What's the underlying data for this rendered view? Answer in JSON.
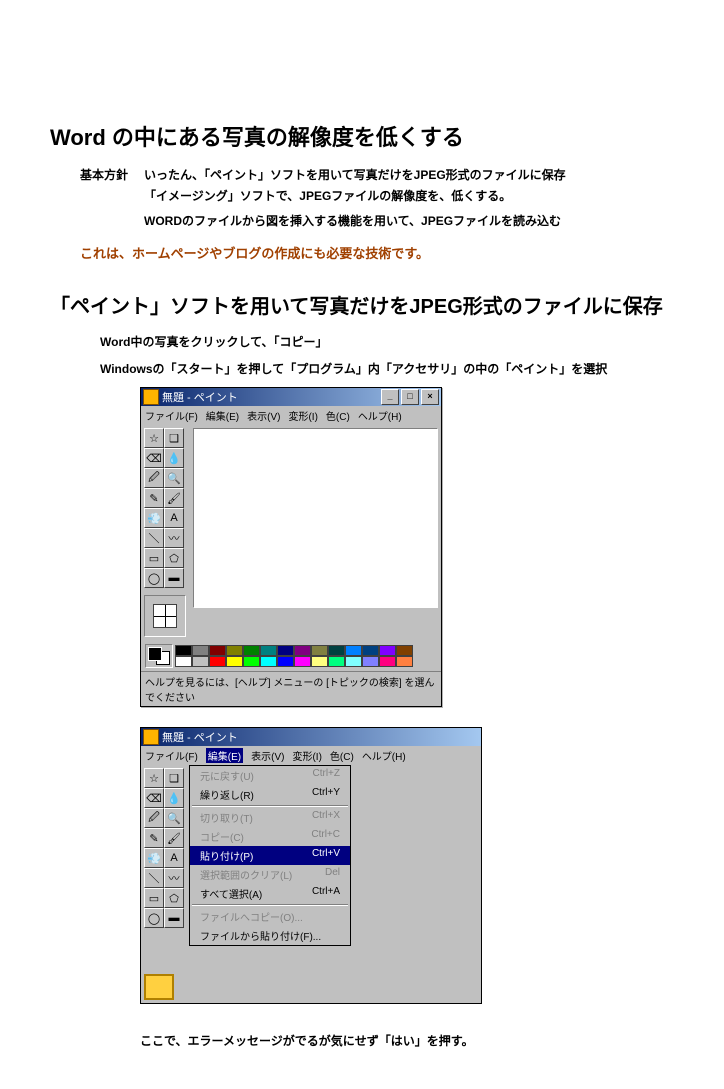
{
  "heading1": "Word の中にある写真の解像度を低くする",
  "policy": {
    "label": "基本方針",
    "lines": [
      "いったん、「ペイント」ソフトを用いて写真だけをJPEG形式のファイルに保存",
      "「イメージング」ソフトで、JPEGファイルの解像度を、低くする。",
      "WORDのファイルから図を挿入する機能を用いて、JPEGファイルを読み込む"
    ]
  },
  "red_note": "これは、ホームページやブログの作成にも必要な技術です。",
  "heading2": "「ペイント」ソフトを用いて写真だけをJPEG形式のファイルに保存",
  "step1": "Word中の写真をクリックして、「コピー」",
  "step2": "Windowsの「スタート」を押して「プログラム」内「アクセサリ」の中の「ペイント」を選択",
  "paint_title": "無題 - ペイント",
  "menu": {
    "file": "ファイル(F)",
    "edit": "編集(E)",
    "view": "表示(V)",
    "image": "変形(I)",
    "colors": "色(C)",
    "help": "ヘルプ(H)"
  },
  "status_text": "ヘルプを見るには、[ヘルプ] メニューの [トピックの検索] を選んでください",
  "palette": [
    "#000000",
    "#808080",
    "#800000",
    "#808000",
    "#008000",
    "#008080",
    "#000080",
    "#800080",
    "#808040",
    "#004040",
    "#0080ff",
    "#004080",
    "#8000ff",
    "#804000",
    "#ffffff",
    "#c0c0c0",
    "#ff0000",
    "#ffff00",
    "#00ff00",
    "#00ffff",
    "#0000ff",
    "#ff00ff",
    "#ffff80",
    "#00ff80",
    "#80ffff",
    "#8080ff",
    "#ff0080",
    "#ff8040"
  ],
  "tools": [
    "☆",
    "❑",
    "⌫",
    "💧",
    "🖉",
    "🔍",
    "✎",
    "🖌",
    "💨",
    "A",
    "＼",
    "〰",
    "▭",
    "⬠",
    "◯",
    "▬"
  ],
  "edit_menu": [
    {
      "label": "元に戻す(U)",
      "shortcut": "Ctrl+Z",
      "disabled": true
    },
    {
      "label": "繰り返し(R)",
      "shortcut": "Ctrl+Y",
      "disabled": false
    },
    {
      "sep": true
    },
    {
      "label": "切り取り(T)",
      "shortcut": "Ctrl+X",
      "disabled": true
    },
    {
      "label": "コピー(C)",
      "shortcut": "Ctrl+C",
      "disabled": true
    },
    {
      "label": "貼り付け(P)",
      "shortcut": "Ctrl+V",
      "disabled": false,
      "highlight": true
    },
    {
      "label": "選択範囲のクリア(L)",
      "shortcut": "Del",
      "disabled": true
    },
    {
      "label": "すべて選択(A)",
      "shortcut": "Ctrl+A",
      "disabled": false
    },
    {
      "sep": true
    },
    {
      "label": "ファイルへコピー(O)...",
      "shortcut": "",
      "disabled": true
    },
    {
      "label": "ファイルから貼り付け(F)...",
      "shortcut": "",
      "disabled": false
    }
  ],
  "final_note": "ここで、エラーメッセージがでるが気にせず「はい」を押す。"
}
